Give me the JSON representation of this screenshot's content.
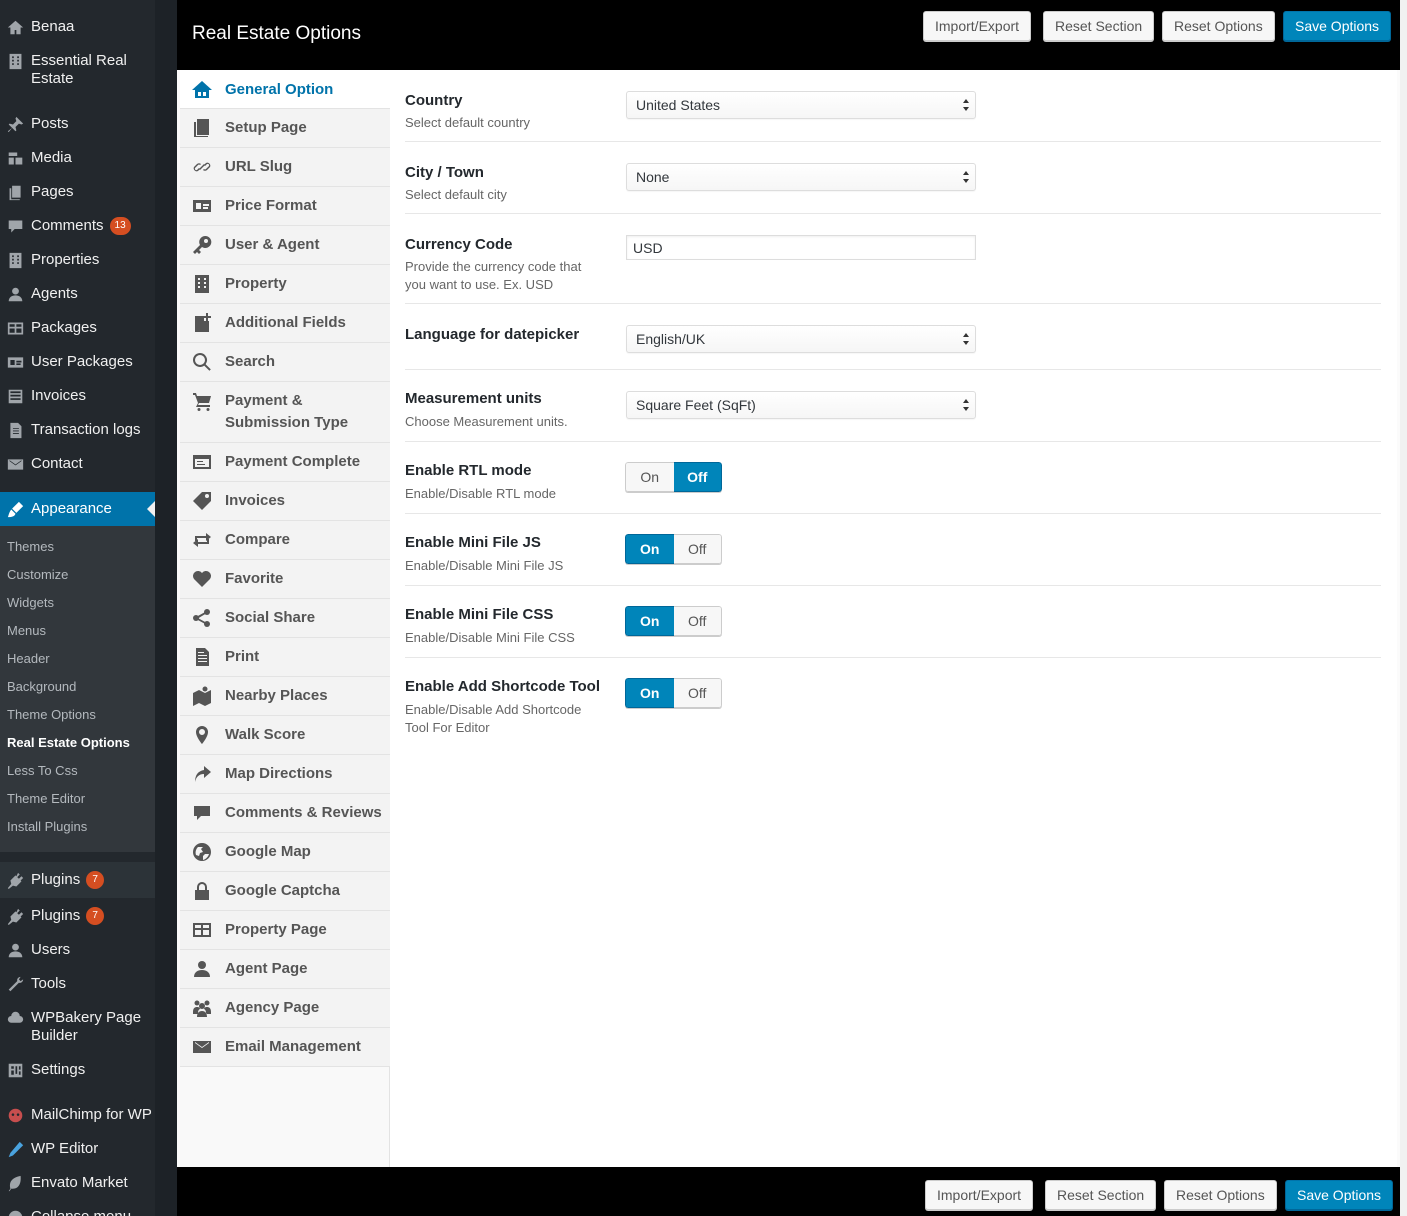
{
  "sidebar": {
    "site_name": "Benaa",
    "items": [
      {
        "label": "Essential Real\nEstate",
        "icon": "building-icon"
      },
      {
        "label": "Posts",
        "icon": "pin-icon"
      },
      {
        "label": "Media",
        "icon": "media-icon"
      },
      {
        "label": "Pages",
        "icon": "page-icon"
      },
      {
        "label": "Comments",
        "icon": "comment-icon",
        "badge": "13"
      },
      {
        "label": "Properties",
        "icon": "building-icon"
      },
      {
        "label": "Agents",
        "icon": "user-icon"
      },
      {
        "label": "Packages",
        "icon": "table-icon"
      },
      {
        "label": "User Packages",
        "icon": "id-card-icon"
      },
      {
        "label": "Invoices",
        "icon": "list-icon"
      },
      {
        "label": "Transaction logs",
        "icon": "document-icon"
      },
      {
        "label": "Contact",
        "icon": "mail-icon"
      },
      {
        "label": "Appearance",
        "icon": "brush-icon"
      }
    ],
    "appearance_submenu": [
      "Themes",
      "Customize",
      "Widgets",
      "Menus",
      "Header",
      "Background",
      "Theme Options",
      "Real Estate Options",
      "Less To Css",
      "Theme Editor",
      "Install Plugins"
    ],
    "current_submenu": "Real Estate Options",
    "lower_items": [
      {
        "label": "Plugins",
        "icon": "plugin-icon",
        "badge": "7"
      },
      {
        "label": "Plugins",
        "icon": "plugin-icon",
        "badge": "7"
      },
      {
        "label": "Users",
        "icon": "user-icon"
      },
      {
        "label": "Tools",
        "icon": "wrench-icon"
      },
      {
        "label": "WPBakery Page\nBuilder",
        "icon": "cloud-icon"
      },
      {
        "label": "Settings",
        "icon": "settings-icon"
      },
      {
        "label": "MailChimp for WP",
        "icon": "mailchimp-icon"
      },
      {
        "label": "WP Editor",
        "icon": "pen-icon"
      },
      {
        "label": "Envato Market",
        "icon": "leaf-icon"
      },
      {
        "label": "Collapse menu",
        "icon": "collapse-icon"
      }
    ]
  },
  "header": {
    "title": "Real Estate Options",
    "buttons": {
      "import_export": "Import/Export",
      "reset_section": "Reset Section",
      "reset_options": "Reset Options",
      "save_options": "Save Options"
    }
  },
  "footer": {
    "buttons": {
      "import_export": "Import/Export",
      "reset_section": "Reset Section",
      "reset_options": "Reset Options",
      "save_options": "Save Options"
    }
  },
  "tabs": [
    {
      "label": "General Option",
      "icon": "houses-icon",
      "active": true
    },
    {
      "label": "Setup Page",
      "icon": "book-icon"
    },
    {
      "label": "URL Slug",
      "icon": "link-icon"
    },
    {
      "label": "Price Format",
      "icon": "id-card-icon"
    },
    {
      "label": "User & Agent",
      "icon": "key-icon"
    },
    {
      "label": "Property",
      "icon": "building-icon"
    },
    {
      "label": "Additional Fields",
      "icon": "add-page-icon"
    },
    {
      "label": "Search",
      "icon": "search-icon"
    },
    {
      "label": "Payment &\nSubmission Type",
      "icon": "cart-icon"
    },
    {
      "label": "Payment Complete",
      "icon": "window-icon"
    },
    {
      "label": "Invoices",
      "icon": "tag-icon"
    },
    {
      "label": "Compare",
      "icon": "swap-icon"
    },
    {
      "label": "Favorite",
      "icon": "heart-icon"
    },
    {
      "label": "Social Share",
      "icon": "share-icon"
    },
    {
      "label": "Print",
      "icon": "print-doc-icon"
    },
    {
      "label": "Nearby Places",
      "icon": "map-people-icon"
    },
    {
      "label": "Walk Score",
      "icon": "map-marker-icon"
    },
    {
      "label": "Map Directions",
      "icon": "redo-arrow-icon"
    },
    {
      "label": "Comments & Reviews",
      "icon": "comment-icon"
    },
    {
      "label": "Google Map",
      "icon": "globe-icon"
    },
    {
      "label": "Google Captcha",
      "icon": "lock-icon"
    },
    {
      "label": "Property Page",
      "icon": "table-icon"
    },
    {
      "label": "Agent Page",
      "icon": "user-icon"
    },
    {
      "label": "Agency Page",
      "icon": "group-icon"
    },
    {
      "label": "Email Management",
      "icon": "mail-icon"
    }
  ],
  "fields": {
    "country": {
      "title": "Country",
      "desc": "Select default country",
      "value": "United States"
    },
    "city": {
      "title": "City / Town",
      "desc": "Select default city",
      "value": "None"
    },
    "currency": {
      "title": "Currency Code",
      "desc": "Provide the currency code that you want to use. Ex. USD",
      "value": "USD"
    },
    "language": {
      "title": "Language for datepicker",
      "value": "English/UK"
    },
    "measurement": {
      "title": "Measurement units",
      "desc": "Choose Measurement units.",
      "value": "Square Feet (SqFt)"
    },
    "rtl": {
      "title": "Enable RTL mode",
      "desc": "Enable/Disable RTL mode",
      "on": "On",
      "off": "Off",
      "state": "off"
    },
    "mini_js": {
      "title": "Enable Mini File JS",
      "desc": "Enable/Disable Mini File JS",
      "on": "On",
      "off": "Off",
      "state": "on"
    },
    "mini_css": {
      "title": "Enable Mini File CSS",
      "desc": "Enable/Disable Mini File CSS",
      "on": "On",
      "off": "Off",
      "state": "on"
    },
    "shortcode": {
      "title": "Enable Add Shortcode Tool",
      "desc": "Enable/Disable Add Shortcode Tool For Editor",
      "on": "On",
      "off": "Off",
      "state": "on"
    }
  },
  "colors": {
    "accent": "#0085ba",
    "sidebar_bg": "#23282d",
    "badge": "#d54e21"
  }
}
